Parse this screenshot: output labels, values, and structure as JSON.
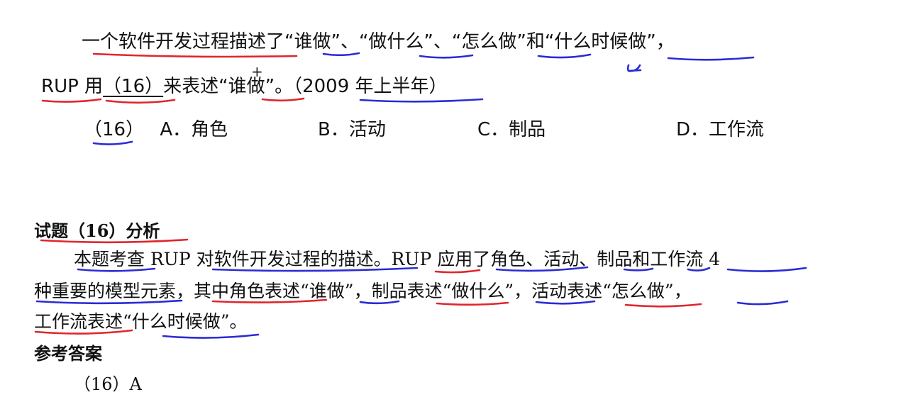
{
  "question": {
    "line1": "一个软件开发过程描述了“谁做”、“做什么”、“怎么做”和“什么时候做”，",
    "line2_prefix": "RUP 用",
    "line2_blank": "（16）",
    "line2_suffix": "来表述“谁做”。（2009 年上半年）",
    "options": [
      {
        "num": "（16）",
        "label": "A．角色"
      },
      {
        "label": "B．活动"
      },
      {
        "label": "C．制品"
      },
      {
        "label": "D．工作流"
      }
    ]
  },
  "analysis": {
    "title": "试题（16）分析",
    "line1": "本题考查 RUP 对软件开发过程的描述。RUP 应用了角色、活动、制品和工作流 4",
    "line2": "种重要的模型元素，其中角色表述“谁做”，制品表述“做什么”，活动表述“怎么做”，",
    "line3": "工作流表述“什么时候做”。"
  },
  "reference": {
    "title": "参考答案",
    "answer": "（16）A"
  },
  "colors": {
    "red_ink": "#e0262b",
    "blue_ink": "#2b2bd6"
  }
}
